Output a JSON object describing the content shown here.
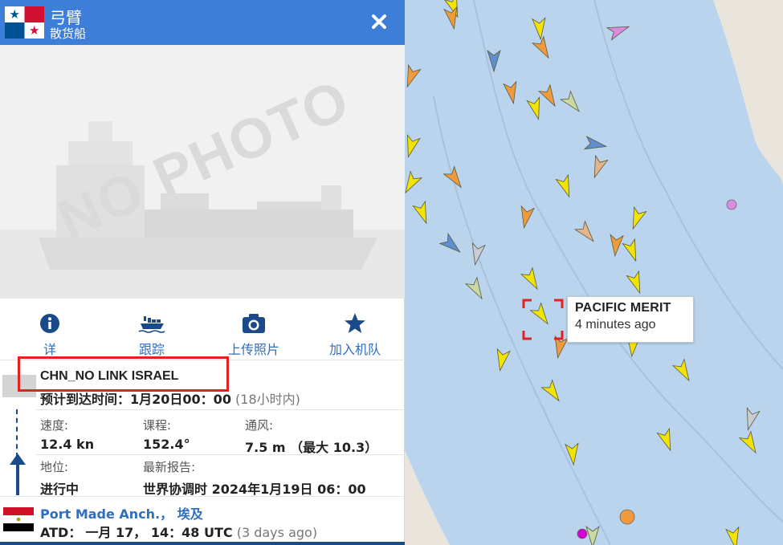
{
  "vessel": {
    "name": "弓臂",
    "type": "散货船",
    "flag_country_icon": "panama-flag-icon"
  },
  "photo": {
    "placeholder_text": "NO PHOTO"
  },
  "actions": [
    {
      "label": "详",
      "icon": "info-icon"
    },
    {
      "label": "跟踪",
      "icon": "ship-track-icon"
    },
    {
      "label": "上传照片",
      "icon": "camera-icon"
    },
    {
      "label": "加入机队",
      "icon": "star-icon"
    }
  ],
  "voyage": {
    "destination": "CHN_NO LINK ISRAEL",
    "eta_label": "预计到达时间：",
    "eta_value": "1月20日00：00",
    "eta_relative": "(18小时内)"
  },
  "stats": {
    "speed_label": "速度:",
    "speed_value": "12.4 kn",
    "course_label": "课程:",
    "course_value": "152.4°",
    "draught_label": "通风:",
    "draught_value": "7.5 m （最大 10.3）",
    "status_label": "地位:",
    "status_value": "进行中",
    "last_report_label": "最新报告:",
    "last_report_value": "世界协调时 2024年1月19日 06：00"
  },
  "departure": {
    "port": "Port Made Anch.， 埃及",
    "atd_label": "ATD：",
    "atd_value": "一月 17， 14：48 UTC",
    "atd_relative": "(3 days ago)",
    "flag_country_icon": "egypt-flag-icon"
  },
  "map": {
    "tooltip_name": "PACIFIC MERIT",
    "tooltip_age": "4 minutes ago",
    "colors": {
      "sea": "#b9d4ec",
      "land": "#e9e4dc",
      "cargo": "#f2e400",
      "tanker": "#f09a3e",
      "passenger": "#5f8fd0",
      "other": "#c9d9a0",
      "selection": "#e5211f"
    }
  },
  "colors": {
    "header_bg": "#3c7ed8",
    "link": "#2f6fbf",
    "highlight": "#e5211f"
  }
}
